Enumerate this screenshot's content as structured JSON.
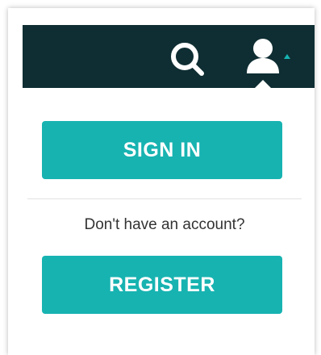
{
  "header": {
    "search_icon": "search-icon",
    "user_icon": "user-icon",
    "caret_icon": "caret-up-icon",
    "background_color": "#0f2e33",
    "icon_color": "#ffffff",
    "caret_color": "#17b3b1"
  },
  "panel": {
    "signin_label": "SIGN IN",
    "prompt_text": "Don't have an account?",
    "register_label": "REGISTER",
    "button_color": "#17b3b1"
  }
}
